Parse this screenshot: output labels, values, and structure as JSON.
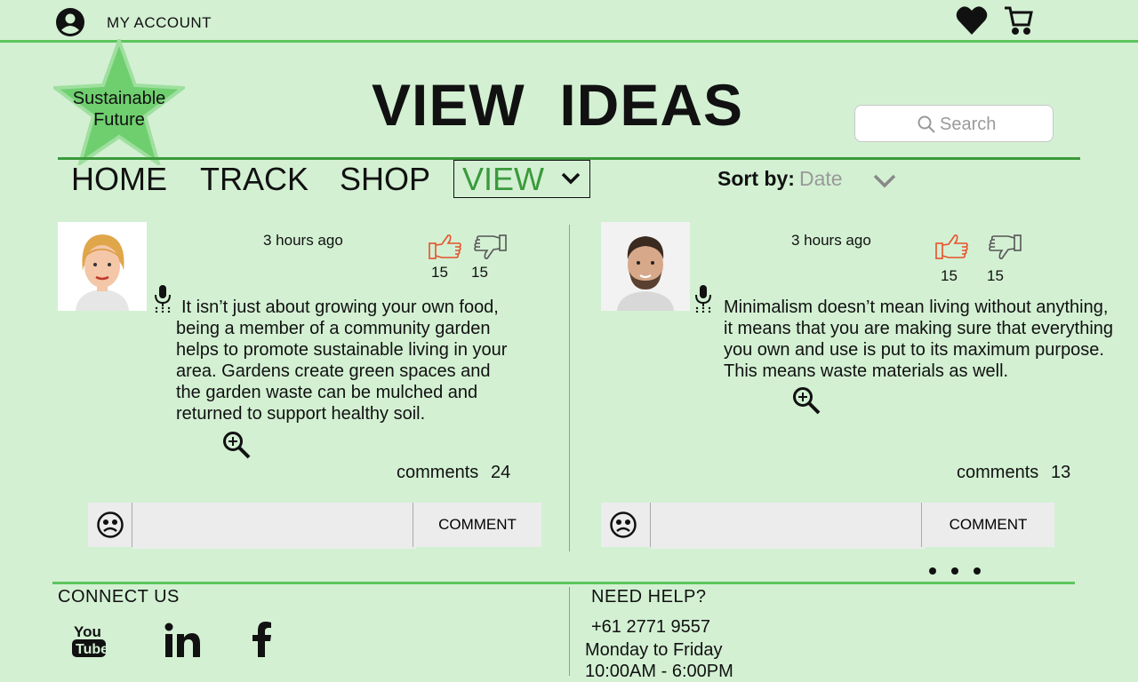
{
  "header": {
    "account_label": "MY  ACCOUNT",
    "account_icon": "account-circle-icon",
    "wishlist_icon": "heart-icon",
    "cart_icon": "cart-icon"
  },
  "logo": {
    "line1": "Sustainable",
    "line2": "Future",
    "color": "#6fcf6f"
  },
  "page_title": "VIEW  IDEAS",
  "search": {
    "placeholder": "Search"
  },
  "nav": {
    "items": [
      {
        "label": "HOME"
      },
      {
        "label": "TRACK"
      },
      {
        "label": "SHOP"
      }
    ],
    "active": {
      "label": "VIEW",
      "color": "#3b9a3b"
    }
  },
  "sort": {
    "label": "Sort by:",
    "value": "Date"
  },
  "posts": [
    {
      "time": "3 hours ago",
      "likes": "15",
      "dislikes": "15",
      "text": "It isn’t just about growing your own food, being a member of a community garden helps to promote sustainable living in your area. Gardens create green spaces and the garden waste can be mulched and returned to support healthy soil.",
      "comments_label": "comments",
      "comments_count": "24",
      "comment_button": "COMMENT"
    },
    {
      "time": "3 hours ago",
      "likes": "15",
      "dislikes": "15",
      "text": "Minimalism doesn’t mean living without anything, it means that you are making sure that everything you own and use is put to its maximum purpose. This means waste materials as well.",
      "comments_label": "comments",
      "comments_count": "13",
      "comment_button": "COMMENT"
    }
  ],
  "footer": {
    "connect_label": "CONNECT   US",
    "social_icons": [
      "youtube-icon",
      "linkedin-icon",
      "facebook-icon"
    ],
    "help_label": "NEED  HELP?",
    "phone": "+61 2771  9557",
    "days": "Monday to  Friday",
    "hours": "10:00AM - 6:00PM"
  },
  "colors": {
    "background": "#d3f0d3",
    "accent_line": "#5cc55c",
    "like": "#e8502a"
  }
}
